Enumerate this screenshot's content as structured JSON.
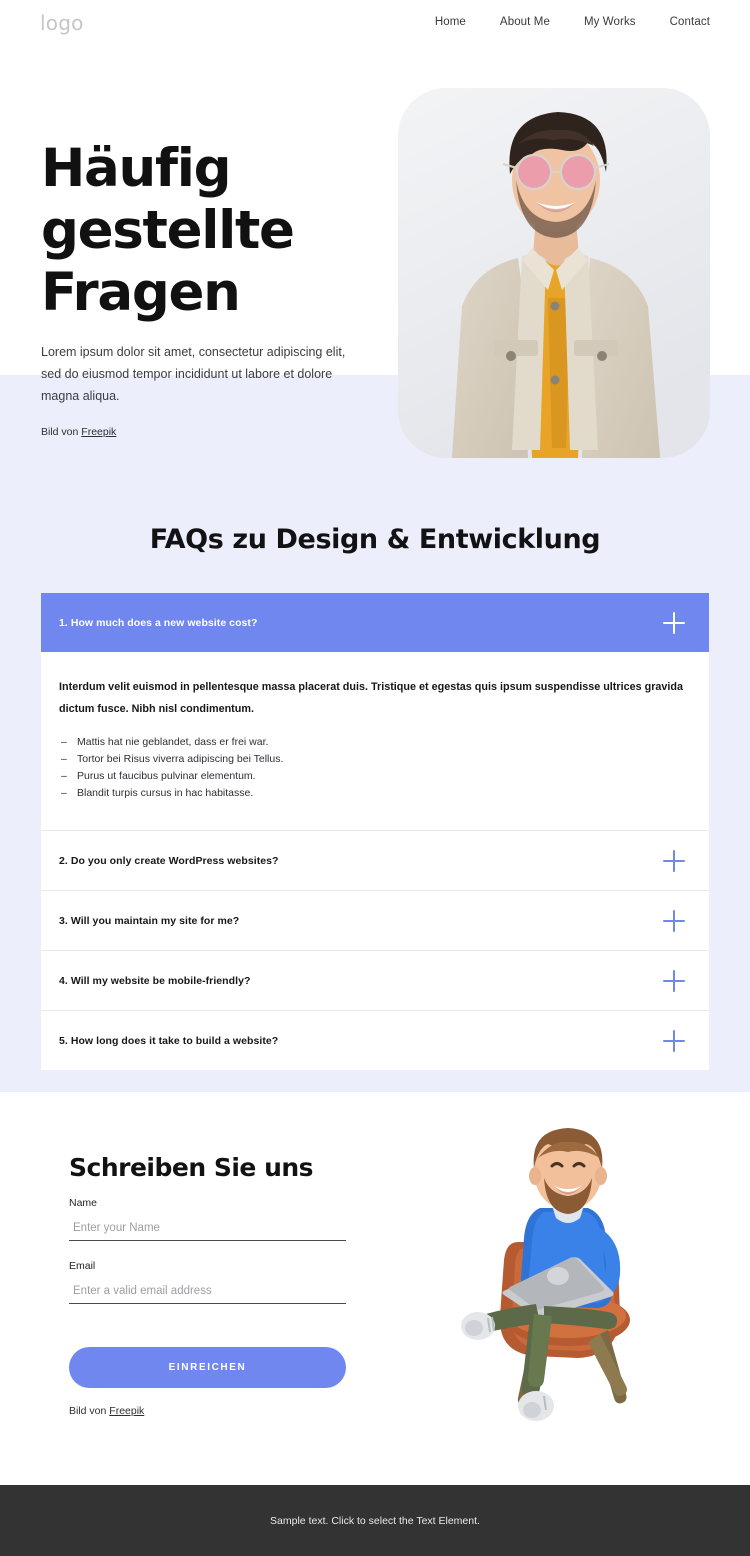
{
  "header": {
    "logo": "logo",
    "nav": [
      {
        "label": "Home"
      },
      {
        "label": "About Me"
      },
      {
        "label": "My Works"
      },
      {
        "label": "Contact"
      }
    ]
  },
  "hero": {
    "title": "Häufig gestellte Fragen",
    "subtitle": "Lorem ipsum dolor sit amet, consectetur adipiscing elit, sed do eiusmod tempor incididunt ut labore et dolore magna aliqua.",
    "credit_prefix": "Bild von ",
    "credit_link": "Freepik",
    "image_alt": "smiling-man-with-pink-sunglasses-and-beige-denim-jacket"
  },
  "faq": {
    "title": "FAQs zu Design & Entwicklung",
    "items": [
      {
        "question": "1. How much does a new website cost?",
        "open": true,
        "lead": "Interdum velit euismod in pellentesque massa placerat duis. Tristique et egestas quis ipsum suspendisse ultrices gravida dictum fusce. Nibh nisl condimentum.",
        "bullets": [
          "Mattis hat nie geblandet, dass er frei war.",
          "Tortor bei Risus viverra adipiscing bei Tellus.",
          "Purus ut faucibus pulvinar elementum.",
          "Blandit turpis cursus in hac habitasse."
        ]
      },
      {
        "question": "2. Do you only create WordPress websites?",
        "open": false
      },
      {
        "question": "3. Will you maintain my site for me?",
        "open": false
      },
      {
        "question": "4. Will my website be mobile-friendly?",
        "open": false
      },
      {
        "question": "5. How long does it take to build a website?",
        "open": false
      }
    ]
  },
  "contact": {
    "title": "Schreiben Sie uns",
    "name_label": "Name",
    "name_placeholder": "Enter your Name",
    "name_value": "",
    "email_label": "Email",
    "email_placeholder": "Enter a valid email address",
    "email_value": "",
    "submit_label": "EINREICHEN",
    "credit_prefix": "Bild von ",
    "credit_link": "Freepik",
    "illustration_alt": "3d-man-with-laptop-sitting-on-orange-chair"
  },
  "footer": {
    "text": "Sample text. Click to select the Text Element."
  },
  "colors": {
    "accent": "#6f87ee",
    "lavender": "#eceffb",
    "footer_bg": "#333333",
    "heading": "#121214"
  }
}
